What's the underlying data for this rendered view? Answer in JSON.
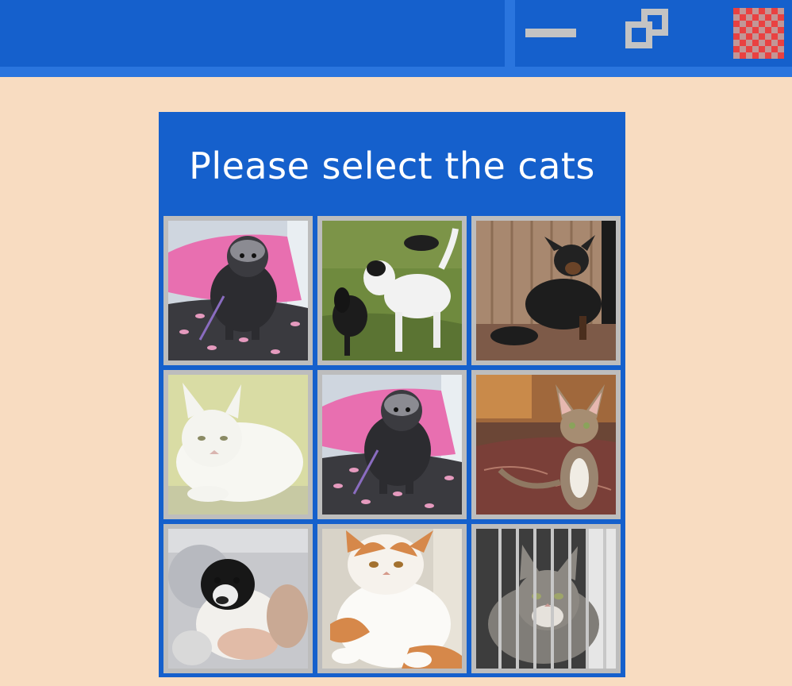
{
  "window": {
    "controls": {
      "minimize_icon": "minimize-icon",
      "restore_icon": "restore-icon",
      "close_icon": "close-icon"
    },
    "colors": {
      "titlebar": "#1560cc",
      "background": "#f8dcc1"
    }
  },
  "captcha": {
    "title": "Please select the cats",
    "tiles": [
      {
        "subject": "small dog on pink pillow"
      },
      {
        "subject": "white and black dogs on grass"
      },
      {
        "subject": "black dog by fence"
      },
      {
        "subject": "white cat"
      },
      {
        "subject": "small dog on pink pillow"
      },
      {
        "subject": "tabby kitten on rug"
      },
      {
        "subject": "puppy held in arms"
      },
      {
        "subject": "orange and white cat"
      },
      {
        "subject": "tabby cat behind bars"
      }
    ]
  }
}
